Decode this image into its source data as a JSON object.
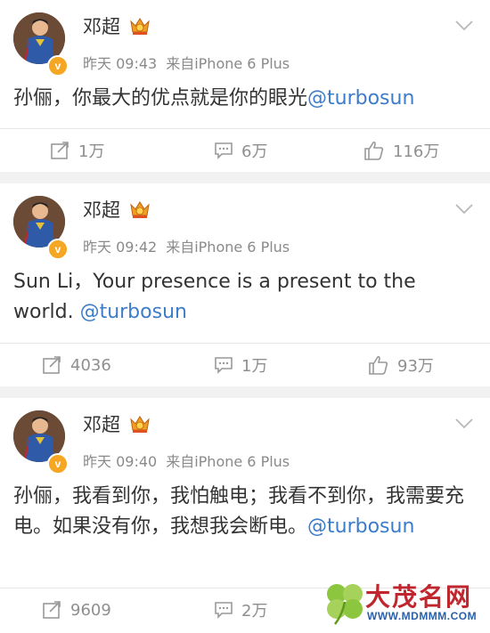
{
  "posts": [
    {
      "author": "邓超",
      "time": "昨天 09:43",
      "source": "来自iPhone 6 Plus",
      "text": "孙俪，你最大的优点就是你的眼光",
      "mention": "@turbosun",
      "reposts": "1万",
      "comments": "6万",
      "likes": "116万"
    },
    {
      "author": "邓超",
      "time": "昨天 09:42",
      "source": "来自iPhone 6 Plus",
      "text": "Sun Li，Your presence is a present to the world. ",
      "mention": "@turbosun",
      "reposts": "4036",
      "comments": "1万",
      "likes": "93万"
    },
    {
      "author": "邓超",
      "time": "昨天 09:40",
      "source": "来自iPhone 6 Plus",
      "text": "孙俪，我看到你，我怕触电；我看不到你，我需要充电。如果没有你，我想我会断电。",
      "mention": "@turbosun",
      "reposts": "9609",
      "comments": "2万",
      "likes": ""
    }
  ],
  "verified_badge": "v",
  "watermark": {
    "title": "大茂名网",
    "url": "WWW.MDMMM.COM"
  },
  "colors": {
    "mention": "#3d7cc9",
    "verified": "#f5a623",
    "background": "#f2f2f2"
  },
  "icons": {
    "repost": "repost-icon",
    "comment": "comment-icon",
    "like": "like-icon",
    "more": "chevron-down-icon",
    "crown": "crown-badge-icon"
  }
}
